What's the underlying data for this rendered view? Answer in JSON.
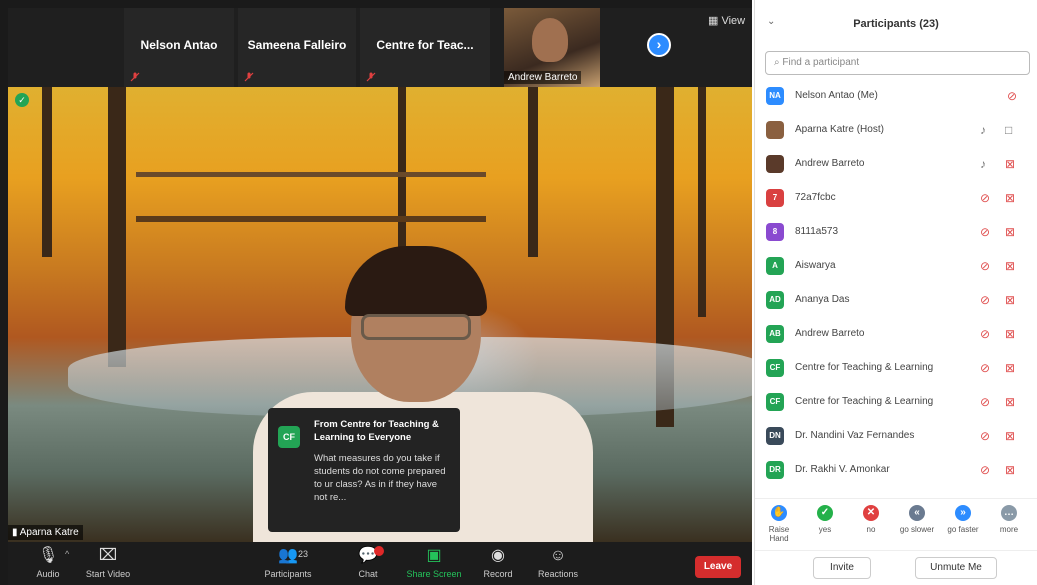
{
  "top_strip": {
    "tiles": [
      {
        "name": "Nelson Antao"
      },
      {
        "name": "Sameena Falleiro"
      },
      {
        "name": "Centre for Teac..."
      }
    ],
    "video_tile_label": "Andrew Barreto",
    "view_label": "View",
    "next_icon": "chevron-right-icon"
  },
  "stage": {
    "speaker_label": "Aparna Katre"
  },
  "chat_popup": {
    "avatar": "CF",
    "from": "From Centre for Teaching & Learning to Everyone",
    "message": "What measures do you take if students do not come prepared to ur class? As in if they have not re..."
  },
  "toolbar": {
    "audio": "Audio",
    "start_video": "Start Video",
    "participants": "Participants",
    "participants_count": "23",
    "chat": "Chat",
    "share_screen": "Share Screen",
    "record": "Record",
    "reactions": "Reactions",
    "leave": "Leave",
    "colors": {
      "green": "#24c15a",
      "leave": "#d52d2d"
    }
  },
  "panel": {
    "title": "Participants (23)",
    "search_placeholder": "Find a participant",
    "participants": [
      {
        "initials": "NA",
        "name": "Nelson Antao (Me)",
        "color": "#2d8cff",
        "mic": "muted",
        "video": ""
      },
      {
        "initials": "",
        "name": "Aparna Katre (Host)",
        "color": "#8a6040",
        "mic": "on",
        "video": "on"
      },
      {
        "initials": "",
        "name": "Andrew Barreto",
        "color": "#5a3a2a",
        "mic": "on",
        "video": "off"
      },
      {
        "initials": "7",
        "name": "72a7fcbc",
        "color": "#d94040",
        "mic": "muted",
        "video": "off"
      },
      {
        "initials": "8",
        "name": "8111a573",
        "color": "#8a4ad0",
        "mic": "muted",
        "video": "off"
      },
      {
        "initials": "A",
        "name": "Aiswarya",
        "color": "#23a455",
        "mic": "muted",
        "video": "off"
      },
      {
        "initials": "AD",
        "name": "Ananya Das",
        "color": "#23a455",
        "mic": "muted",
        "video": "off"
      },
      {
        "initials": "AB",
        "name": "Andrew Barreto",
        "color": "#23a455",
        "mic": "muted",
        "video": "off"
      },
      {
        "initials": "CF",
        "name": "Centre for Teaching & Learning",
        "color": "#23a455",
        "mic": "muted",
        "video": "off"
      },
      {
        "initials": "CF",
        "name": "Centre for Teaching & Learning",
        "color": "#23a455",
        "mic": "muted",
        "video": "off"
      },
      {
        "initials": "DN",
        "name": "Dr. Nandini Vaz Fernandes",
        "color": "#3a4a5a",
        "mic": "muted",
        "video": "off"
      },
      {
        "initials": "DR",
        "name": "Dr. Rakhi V. Amonkar",
        "color": "#23a455",
        "mic": "muted",
        "video": "off"
      }
    ],
    "reactions": [
      {
        "label": "Raise Hand",
        "color": "#2d8cff"
      },
      {
        "label": "yes",
        "color": "#24b14a"
      },
      {
        "label": "no",
        "color": "#e04040"
      },
      {
        "label": "go slower",
        "color": "#6a7a90"
      },
      {
        "label": "go faster",
        "color": "#2d8cff"
      },
      {
        "label": "more",
        "color": "#8a9aa8"
      }
    ],
    "invite": "Invite",
    "unmute_me": "Unmute Me"
  }
}
